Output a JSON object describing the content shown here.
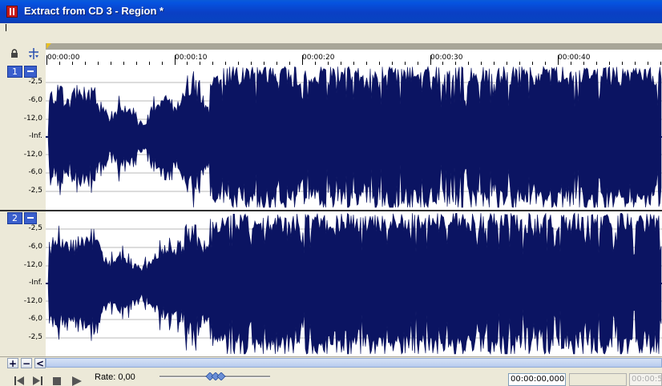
{
  "window": {
    "title": "Extract from CD 3 - Region *"
  },
  "colors": {
    "waveform": "#0b1462",
    "grid": "#b8b8b8",
    "titlebar": "#0a3fc4"
  },
  "ruler": {
    "labels": [
      "00:00:00",
      "00:00:10",
      "00:00:20",
      "00:00:30",
      "00:00:40"
    ]
  },
  "channels": [
    {
      "number": "1",
      "db_labels": [
        "-2,5",
        "-6,0",
        "-12,0",
        "-Inf.",
        "-12,0",
        "-6,0",
        "-2,5"
      ]
    },
    {
      "number": "2",
      "db_labels": [
        "-2,5",
        "-6,0",
        "-12,0",
        "-Inf.",
        "-12,0",
        "-6,0",
        "-2,5"
      ]
    }
  ],
  "icons": {
    "lock": "lock-icon",
    "snap": "snap-icon",
    "zoom_in": "plus-icon",
    "zoom_out": "minus-icon",
    "scroll_left": "chevron-left-icon",
    "prev": "go-to-start-icon",
    "next": "go-to-end-icon",
    "stop": "stop-icon",
    "play": "play-icon"
  },
  "scroll": {
    "zoom_in": "+",
    "zoom_out": "−",
    "left": "<"
  },
  "transport": {
    "rate_label": "Rate: 0,00",
    "position_time": "00:00:00,000",
    "length_time": "",
    "end_time": "00:00:5"
  }
}
